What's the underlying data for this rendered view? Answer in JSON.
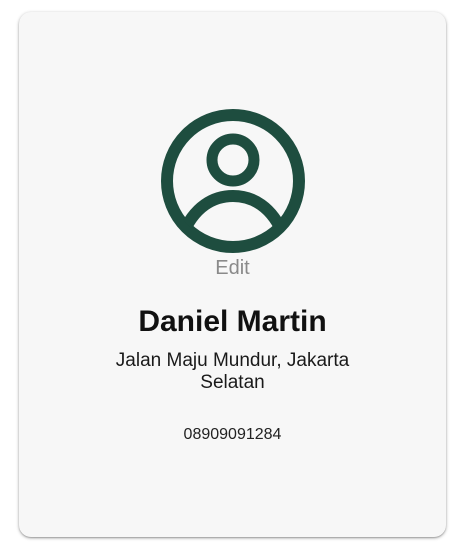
{
  "profile": {
    "edit_label": "Edit",
    "name": "Daniel Martin",
    "address": "Jalan Maju Mundur, Jakarta Selatan",
    "phone": "08909091284",
    "avatar_icon": "user-circle-icon",
    "accent_color": "#1e4d3f"
  }
}
